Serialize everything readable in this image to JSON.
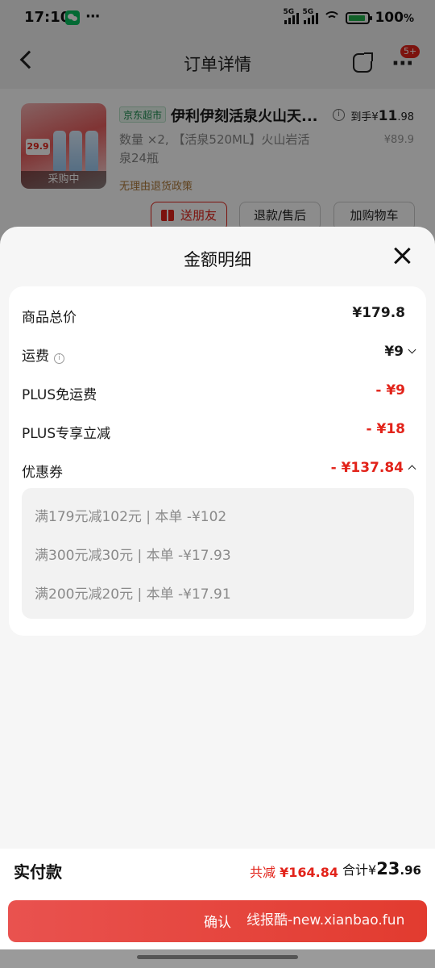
{
  "status_bar": {
    "time": "17:10",
    "more": "···",
    "network_1": "5G",
    "network_2": "5G",
    "battery": "100",
    "battery_unit": "%"
  },
  "nav": {
    "title": "订单详情",
    "badge": "5+"
  },
  "product": {
    "tag": "京东超市",
    "name": "伊利伊刻活泉火山天...",
    "price_prefix": "到手¥",
    "price_int": "11",
    "price_dec": ".98",
    "original_price": "¥89.9",
    "description": "数量 ×2, 【活泉520ML】火山岩活泉24瓶",
    "policy": "无理由退货政策",
    "thumb_price": "29.9",
    "thumb_status": "采购中",
    "buttons": [
      "送朋友",
      "退款/售后",
      "加购物车"
    ]
  },
  "sheet": {
    "title": "金额明细",
    "rows": [
      {
        "label": "商品总价",
        "value": "¥179.8"
      },
      {
        "label": "运费",
        "value": "¥9"
      },
      {
        "label": "PLUS免运费",
        "value": "- ¥9"
      },
      {
        "label": "PLUS专享立减",
        "value": "- ¥18"
      },
      {
        "label": "优惠券",
        "value": "- ¥137.84"
      }
    ],
    "coupons": [
      "满179元减102元 | 本单 -¥102",
      "满300元减30元 | 本单 -¥17.93",
      "满200元减20元 | 本单 -¥17.91"
    ]
  },
  "footer": {
    "label": "实付款",
    "saved_prefix": "共减",
    "saved_value": "¥164.84",
    "total_prefix": "合计¥",
    "total_int": "23",
    "total_dec": ".96",
    "confirm": "确认",
    "watermark": "线报酷-new.xianbao.fun"
  },
  "colors": {
    "accent_red": "#e2231a",
    "confirm_gradient_start": "#e9524f",
    "sheet_bg": "#f6f6f6"
  }
}
